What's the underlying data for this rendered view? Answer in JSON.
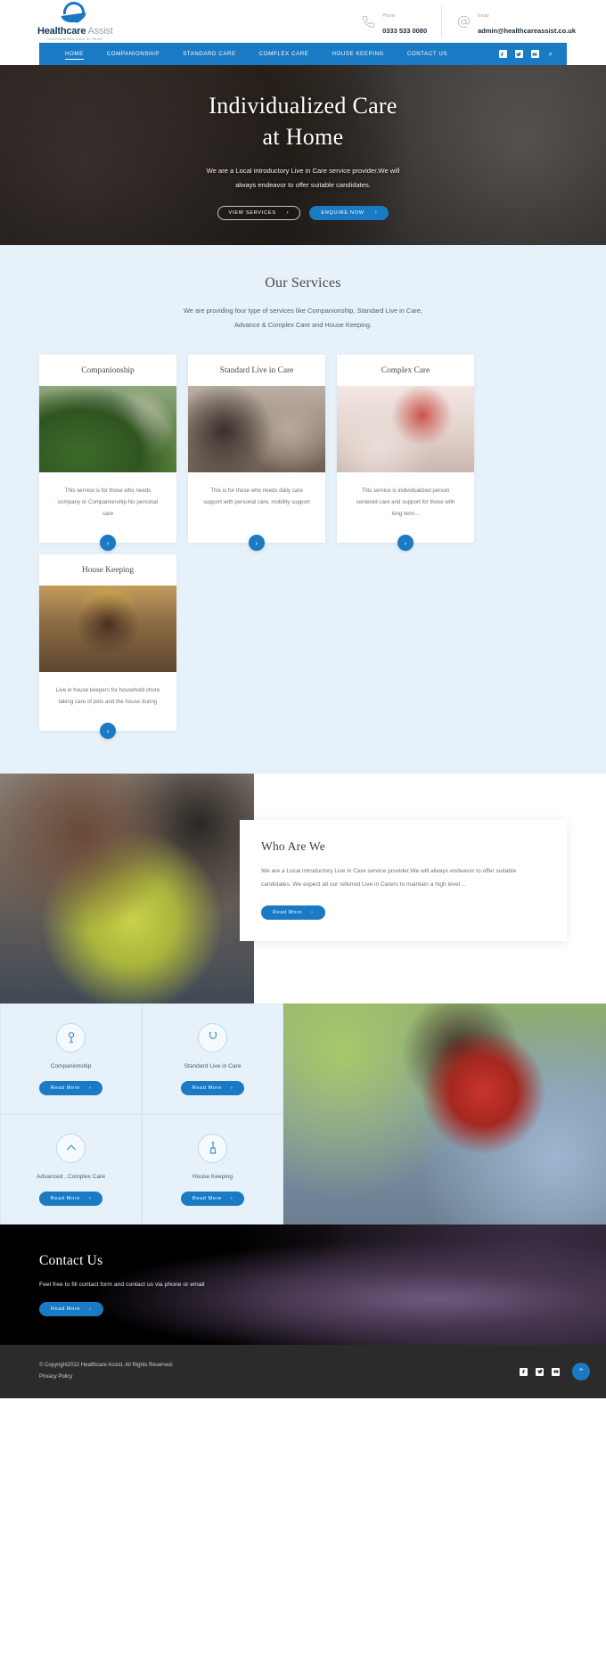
{
  "brand": {
    "name_bold": "Healthcare",
    "name_light": " Assist",
    "tagline": "Individualised Care at Home"
  },
  "header": {
    "phone_label": "Phone",
    "phone_value": "0333 533 0080",
    "email_label": "Email",
    "email_value": "admin@healthcareassist.co.uk"
  },
  "nav": {
    "items": [
      {
        "label": "HOME",
        "active": true
      },
      {
        "label": "COMPANIONSHIP",
        "active": false
      },
      {
        "label": "STANDARD CARE",
        "active": false
      },
      {
        "label": "COMPLEX CARE",
        "active": false
      },
      {
        "label": "HOUSE KEEPING",
        "active": false
      },
      {
        "label": "CONTACT US",
        "active": false
      }
    ],
    "social": [
      "facebook-icon",
      "twitter-icon",
      "youtube-icon"
    ],
    "search": "search-icon"
  },
  "hero": {
    "title_line1": "Individualized Care",
    "title_line2": "at Home",
    "subtitle": "We are a Local introductory Live in Care service provider.We will always endeavor to offer suitable candidates.",
    "btn_primary_ghost": "VIEW SERVICES",
    "btn_primary": "ENQUIRE NOW"
  },
  "services": {
    "title": "Our Services",
    "subtitle": "We are providing four type of services like Companionship, Standard Live in Care, Advance & Complex Care and House Keeping.",
    "cards": [
      {
        "title": "Companionship",
        "desc": "This service is for those who needs company or Companionship.No personal care",
        "arrow": "chevron-right-icon"
      },
      {
        "title": "Standard Live in Care",
        "desc": "This is for those who needs daily care support with personal care, mobility support",
        "arrow": "chevron-right-icon"
      },
      {
        "title": "Complex Care",
        "desc": "This service is individualized person centered care and support for those with long term...",
        "arrow": "chevron-right-icon"
      },
      {
        "title": "House Keeping",
        "desc": "Live in house keepers for household chore taking care of pets and the house during",
        "arrow": "chevron-right-icon"
      }
    ]
  },
  "who": {
    "title": "Who Are We",
    "body": "We are a  Local introductory Live in Care service provider.We will always endeavor to offer suitable candidates. We expect all our referred Live in Carers to maintain a high level ...",
    "button": "Read More"
  },
  "features": [
    {
      "name": "Companionship",
      "icon": "companionship-icon",
      "button": "Read More"
    },
    {
      "name": "Standard Live in Care",
      "icon": "standard-care-icon",
      "button": "Read More"
    },
    {
      "name": "Advanced , Complex Care",
      "icon": "complex-care-icon",
      "button": "Read More"
    },
    {
      "name": "House Keeping",
      "icon": "house-keeping-icon",
      "button": "Read More"
    }
  ],
  "contact": {
    "title": "Contact Us",
    "subtitle": "Feel free to fill contact form and contact us via phone or email",
    "button": "Read More"
  },
  "footer": {
    "copyright": "© Copyright2022 Healthcare Assist. All Rights Reserved.",
    "privacy": "Privacy Policy",
    "social": [
      "facebook-icon",
      "twitter-icon",
      "youtube-icon"
    ],
    "to_top": "chevron-up-icon"
  },
  "colors": {
    "accent": "#1a7ac4",
    "section_bg": "#e7f1f9",
    "footer_bg": "#2b2b2b"
  }
}
